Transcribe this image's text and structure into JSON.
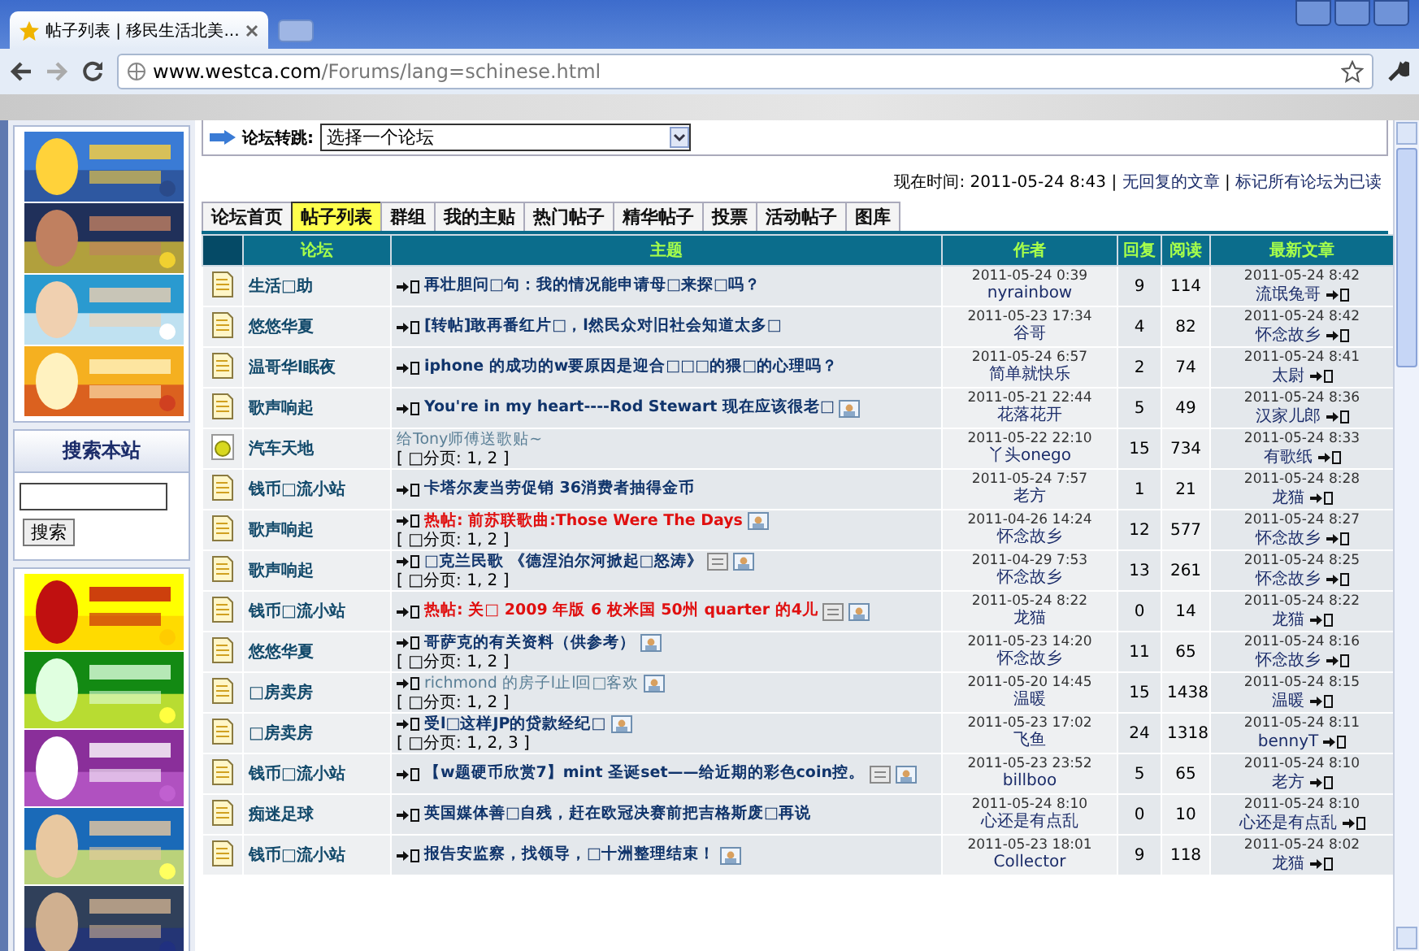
{
  "browser": {
    "tab_title": "帖子列表 | 移民生活北美...",
    "url_host": "www.westca.com",
    "url_path": "/Forums/lang=schinese.html"
  },
  "sidebar": {
    "top_ads": [
      {
        "kind": "picture"
      },
      {
        "kind": "picture"
      },
      {
        "kind": "picture"
      },
      {
        "kind": "picture"
      }
    ],
    "search": {
      "title": "搜索本站",
      "button": "搜索"
    },
    "bottom_ads": [
      {
        "kind": "picture"
      },
      {
        "kind": "picture"
      },
      {
        "kind": "picture"
      },
      {
        "kind": "picture"
      },
      {
        "kind": "picture"
      }
    ]
  },
  "forum_jump": {
    "label": "论坛转跳:",
    "select": "选择一个论坛"
  },
  "info": {
    "time": "现在时间: 2011-05-24 8:43",
    "separator": "|",
    "links": [
      "无回复的文章",
      "标记所有论坛为已读"
    ]
  },
  "tabs": [
    {
      "label": "论坛首页",
      "selected": false
    },
    {
      "label": "帖子列表",
      "selected": true
    },
    {
      "label": "群组",
      "selected": false
    },
    {
      "label": "我的主贴",
      "selected": false
    },
    {
      "label": "热门帖子",
      "selected": false
    },
    {
      "label": "精华帖子",
      "selected": false
    },
    {
      "label": "投票",
      "selected": false
    },
    {
      "label": "活动帖子",
      "selected": false
    },
    {
      "label": "图库",
      "selected": false
    }
  ],
  "table": {
    "columns": [
      "论坛",
      "主题",
      "作者",
      "回复",
      "阅读",
      "最新文章"
    ],
    "rows": [
      {
        "kind": "doc",
        "forum": "生活□助",
        "title": "再壮胆问□句：我的情况能申请母□来探□吗？",
        "hot": false,
        "visited": false,
        "date": "2011-05-24 0:39",
        "author": "nyrainbow",
        "replies": "9",
        "views": "114",
        "last_date": "2011-05-24 8:42",
        "last_author": "流氓兔哥"
      },
      {
        "kind": "doc",
        "forum": "悠悠华夏",
        "title": "[转帖]敢再番红片□，l然民众对旧社会知道太多□",
        "hot": false,
        "visited": false,
        "date": "2011-05-23 17:34",
        "author": "谷哥",
        "replies": "4",
        "views": "82",
        "last_date": "2011-05-24 8:42",
        "last_author": "怀念故乡"
      },
      {
        "kind": "doc",
        "forum": "温哥华l眠夜",
        "title": "iphone 的成功的w要原因是迎合□□□的猥□的心理吗？",
        "hot": false,
        "visited": false,
        "date": "2011-05-24 6:57",
        "author": "简单就快乐",
        "replies": "2",
        "views": "74",
        "last_date": "2011-05-24 8:41",
        "last_author": "太尉"
      },
      {
        "kind": "doc",
        "forum": "歌声响起",
        "title": "You're in my heart----Rod Stewart 现在应该很老□",
        "hot": false,
        "visited": false,
        "attachments": [
          {
            "kind": "picture"
          }
        ],
        "date": "2011-05-21 22:44",
        "author": "花落花开",
        "replies": "5",
        "views": "49",
        "last_date": "2011-05-24 8:36",
        "last_author": "汉家儿郎"
      },
      {
        "kind": "ball",
        "forum": "汽车天地",
        "title": "给Tony师傅送歌贴~",
        "hot": false,
        "visited": true,
        "pages": "[ □分页: 1, 2 ]",
        "date": "2011-05-22 22:10",
        "author": "丫头onego",
        "replies": "15",
        "views": "734",
        "last_date": "2011-05-24 8:33",
        "last_author": "有歌纸"
      },
      {
        "kind": "doc",
        "forum": "钱币□流小站",
        "title": "卡塔尔麦当劳促销 36消费者抽得金币",
        "hot": false,
        "visited": false,
        "date": "2011-05-24 7:57",
        "author": "老方",
        "replies": "1",
        "views": "21",
        "last_date": "2011-05-24 8:28",
        "last_author": "龙猫"
      },
      {
        "kind": "doc",
        "forum": "歌声响起",
        "title": "热帖: 前苏联歌曲:Those Were The Days",
        "hot": true,
        "visited": false,
        "attachments": [
          {
            "kind": "picture"
          }
        ],
        "pages": "[ □分页: 1, 2 ]",
        "date": "2011-04-26 14:24",
        "author": "怀念故乡",
        "replies": "12",
        "views": "577",
        "last_date": "2011-05-24 8:27",
        "last_author": "怀念故乡"
      },
      {
        "kind": "doc",
        "forum": "歌声响起",
        "title": "□克兰民歌 《德涅泊尔河掀起□怒涛》",
        "hot": false,
        "visited": false,
        "attachments": [
          {
            "kind": "file"
          },
          {
            "kind": "picture"
          }
        ],
        "pages": "[ □分页: 1, 2 ]",
        "date": "2011-04-29 7:53",
        "author": "怀念故乡",
        "replies": "13",
        "views": "261",
        "last_date": "2011-05-24 8:25",
        "last_author": "怀念故乡"
      },
      {
        "kind": "doc",
        "forum": "钱币□流小站",
        "title": "热帖: 关□ 2009 年版 6 枚米国 50州 quarter 的4儿",
        "hot": true,
        "visited": false,
        "attachments": [
          {
            "kind": "file"
          },
          {
            "kind": "picture"
          }
        ],
        "date": "2011-05-24 8:22",
        "author": "龙猫",
        "replies": "0",
        "views": "14",
        "last_date": "2011-05-24 8:22",
        "last_author": "龙猫"
      },
      {
        "kind": "doc",
        "forum": "悠悠华夏",
        "title": "哥萨克的有关资料（供参考）",
        "hot": false,
        "visited": false,
        "attachments": [
          {
            "kind": "picture"
          }
        ],
        "pages": "[ □分页: 1, 2 ]",
        "date": "2011-05-23 14:20",
        "author": "怀念故乡",
        "replies": "11",
        "views": "65",
        "last_date": "2011-05-24 8:16",
        "last_author": "怀念故乡"
      },
      {
        "kind": "doc",
        "forum": "□房卖房",
        "title": "richmond 的房子l止l回□客欢",
        "hot": false,
        "visited": true,
        "attachments": [
          {
            "kind": "picture"
          }
        ],
        "pages": "[ □分页: 1, 2 ]",
        "date": "2011-05-20 14:45",
        "author": "温暖",
        "replies": "15",
        "views": "1438",
        "last_date": "2011-05-24 8:15",
        "last_author": "温暖"
      },
      {
        "kind": "doc",
        "forum": "□房卖房",
        "title": "受l□这样JP的贷款经纪□",
        "hot": false,
        "visited": false,
        "attachments": [
          {
            "kind": "picture"
          }
        ],
        "pages": "[ □分页: 1, 2, 3 ]",
        "date": "2011-05-23 17:02",
        "author": "飞鱼",
        "replies": "24",
        "views": "1318",
        "last_date": "2011-05-24 8:11",
        "last_author": "bennyT"
      },
      {
        "kind": "doc",
        "forum": "钱币□流小站",
        "title": "【w题硬币欣赏7】mint 圣诞set——给近期的彩色coin控。",
        "hot": false,
        "visited": false,
        "attachments": [
          {
            "kind": "file"
          },
          {
            "kind": "picture"
          }
        ],
        "date": "2011-05-23 23:52",
        "author": "billboo",
        "replies": "5",
        "views": "65",
        "last_date": "2011-05-24 8:10",
        "last_author": "老方"
      },
      {
        "kind": "doc",
        "forum": "痴迷足球",
        "title": "英国媒体善□自残，赶在欧冠决赛前把吉格斯废□再说",
        "hot": false,
        "visited": false,
        "date": "2011-05-24 8:10",
        "author": "心还是有点乱",
        "replies": "0",
        "views": "10",
        "last_date": "2011-05-24 8:10",
        "last_author": "心还是有点乱"
      },
      {
        "kind": "doc",
        "forum": "钱币□流小站",
        "title": "报告安监察，找领导，□十洲整理结束！",
        "hot": false,
        "visited": false,
        "attachments": [
          {
            "kind": "picture"
          }
        ],
        "date": "2011-05-23 18:01",
        "author": "Collector",
        "replies": "9",
        "views": "118",
        "last_date": "2011-05-24 8:02",
        "last_author": "龙猫"
      }
    ]
  }
}
